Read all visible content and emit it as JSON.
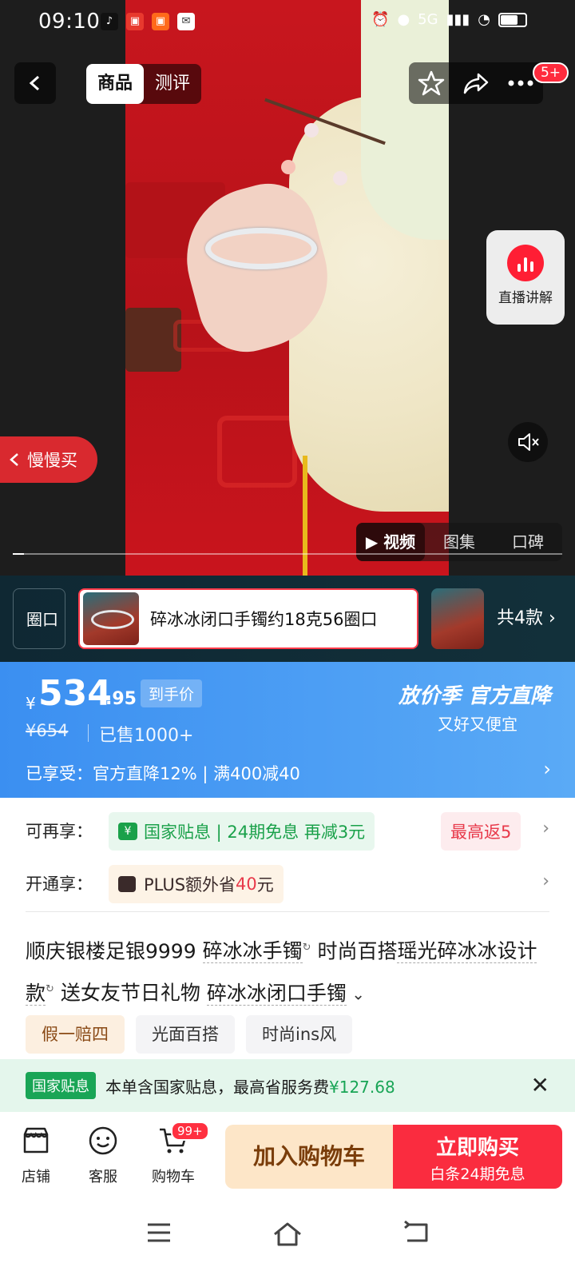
{
  "status_bar": {
    "time": "09:10",
    "network": "5G",
    "battery_level": 0.7,
    "apps": [
      {
        "name": "tiktok-icon",
        "color": "#111111"
      },
      {
        "name": "app-icon-red",
        "color": "#e8392e"
      },
      {
        "name": "app-icon-orange",
        "color": "#ff6a1a"
      },
      {
        "name": "mail-icon",
        "color": "#ffffff"
      }
    ]
  },
  "header": {
    "tabs": [
      "商品",
      "测评"
    ],
    "active_tab": "商品",
    "notification_badge": "5+"
  },
  "live": {
    "label": "直播讲解"
  },
  "slow_buy": {
    "label": "慢慢买"
  },
  "media_tabs": {
    "items": [
      "▶ 视频",
      "图集",
      "口碑"
    ],
    "active": 0,
    "progress": 0.02
  },
  "sku": {
    "left_partial": "圈口",
    "selected_name": "碎冰冰闭口手镯约18克56圈口",
    "total_label": "共4款"
  },
  "price": {
    "currency": "¥",
    "integer": "534",
    "decimal": ".95",
    "tag": "到手价",
    "original": "¥654",
    "sold": "已售1000+",
    "promo_title": "放价季 官方直降",
    "promo_sub": "又好又便宜",
    "enjoyed": "已享受：官方直降12% | 满400减40"
  },
  "benefits": {
    "row1_label": "可再享：",
    "row1_pills": [
      {
        "text": "国家贴息 | 24期免息 再减3元",
        "color": "#1aa14a",
        "bg": "#e8f7ee"
      },
      {
        "text": "最高返5",
        "color": "#e8394a",
        "bg": "#fdecee"
      }
    ],
    "row2_label": "开通享：",
    "row2_pill_prefix": "PLUS额外省",
    "row2_pill_amount": "40",
    "row2_pill_suffix": "元"
  },
  "title": {
    "part1": "顺庆银楼足银9999 ",
    "keyword1": "碎冰冰手镯",
    "part2": " 时尚百搭",
    "keyword2": "瑶光碎冰冰设计款",
    "part3": " 送女友节日礼物 ",
    "keyword3": "碎冰冰闭口手镯"
  },
  "tags": [
    "假一赔四",
    "光面百搭",
    "时尚ins风"
  ],
  "notice": {
    "tag": "国家贴息",
    "text": "本单含国家贴息，最高省服务费",
    "amount": "¥127.68"
  },
  "action_bar": {
    "shop": "店铺",
    "service": "客服",
    "cart": "购物车",
    "cart_badge": "99+",
    "add_to_cart": "加入购物车",
    "buy_now": "立即购买",
    "buy_sub": "白条24期免息"
  },
  "colors": {
    "accent_red": "#fa2c3f",
    "price_blue": "#3b8ff1",
    "gov_green": "#19a556"
  }
}
